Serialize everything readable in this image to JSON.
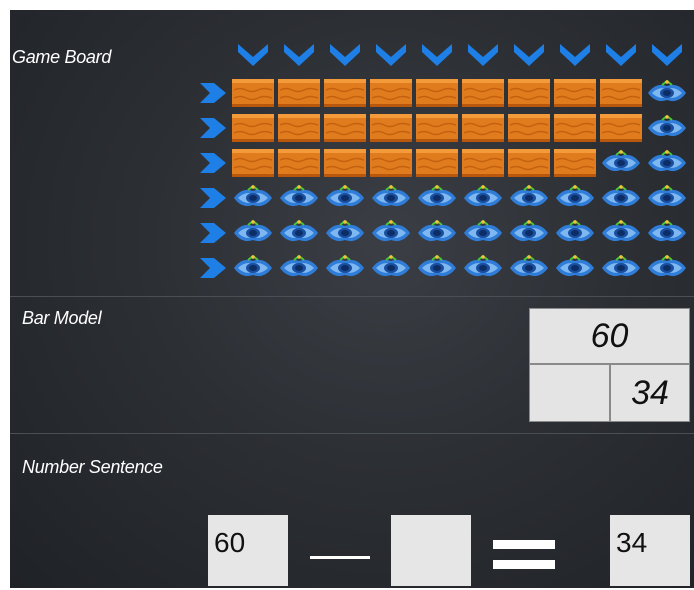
{
  "labels": {
    "game_board": "Game Board",
    "bar_model": "Bar Model",
    "number_sentence": "Number Sentence"
  },
  "board": {
    "columns": 10,
    "rows": 6,
    "filled_cells": [
      9,
      9,
      8,
      0,
      0,
      0
    ],
    "filled_icon": "orange-brick",
    "empty_icon": "blue-fish",
    "arrow_icon": "chevron-arrow",
    "colors": {
      "brick": "#e07c1e",
      "arrow": "#1e7fe6",
      "fish": "#2f7dd8"
    }
  },
  "bar_model": {
    "total": "60",
    "part_unknown": "",
    "part_known": "34"
  },
  "number_sentence": {
    "minuend": "60",
    "subtrahend": "",
    "result": "34"
  }
}
